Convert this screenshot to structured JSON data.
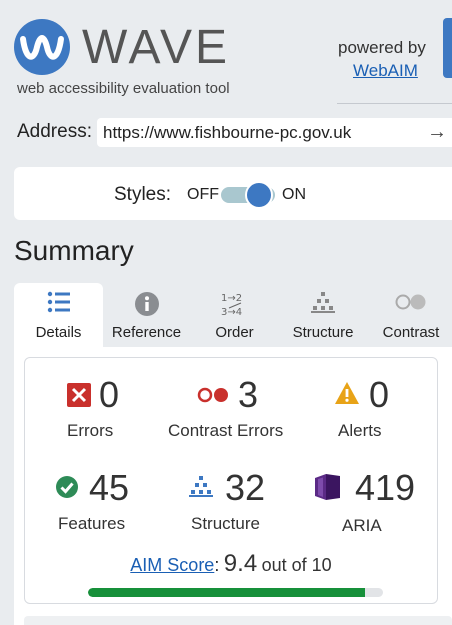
{
  "header": {
    "app_name": "WAVE",
    "tagline": "web accessibility evaluation tool",
    "powered_by": "powered by",
    "webaim_link": "WebAIM"
  },
  "address": {
    "label": "Address:",
    "value": "https://www.fishbourne-pc.gov.uk",
    "go_icon": "arrow-right-icon"
  },
  "styles": {
    "label": "Styles:",
    "off": "OFF",
    "on": "ON",
    "state": "on"
  },
  "summary": {
    "title": "Summary",
    "tabs": [
      {
        "label": "Details",
        "icon": "list-icon",
        "active": true
      },
      {
        "label": "Reference",
        "icon": "info-icon",
        "active": false
      },
      {
        "label": "Order",
        "icon": "order-icon",
        "active": false
      },
      {
        "label": "Structure",
        "icon": "structure-icon",
        "active": false
      },
      {
        "label": "Contrast",
        "icon": "contrast-icon",
        "active": false
      }
    ],
    "stats": {
      "errors": {
        "count": "0",
        "label": "Errors",
        "color": "#c9302c"
      },
      "contrast_errors": {
        "count": "3",
        "label": "Contrast Errors",
        "color": "#c9302c"
      },
      "alerts": {
        "count": "0",
        "label": "Alerts",
        "color": "#e8a317"
      },
      "features": {
        "count": "45",
        "label": "Features",
        "color": "#2e8b57"
      },
      "structure": {
        "count": "32",
        "label": "Structure",
        "color": "#3d78c2"
      },
      "aria": {
        "count": "419",
        "label": "ARIA",
        "color": "#5b2a86"
      }
    },
    "aim": {
      "link": "AIM Score",
      "colon": ":",
      "score": "9.4",
      "out_of": "out of 10",
      "fraction": 0.94,
      "bar_color": "#17903a"
    }
  }
}
